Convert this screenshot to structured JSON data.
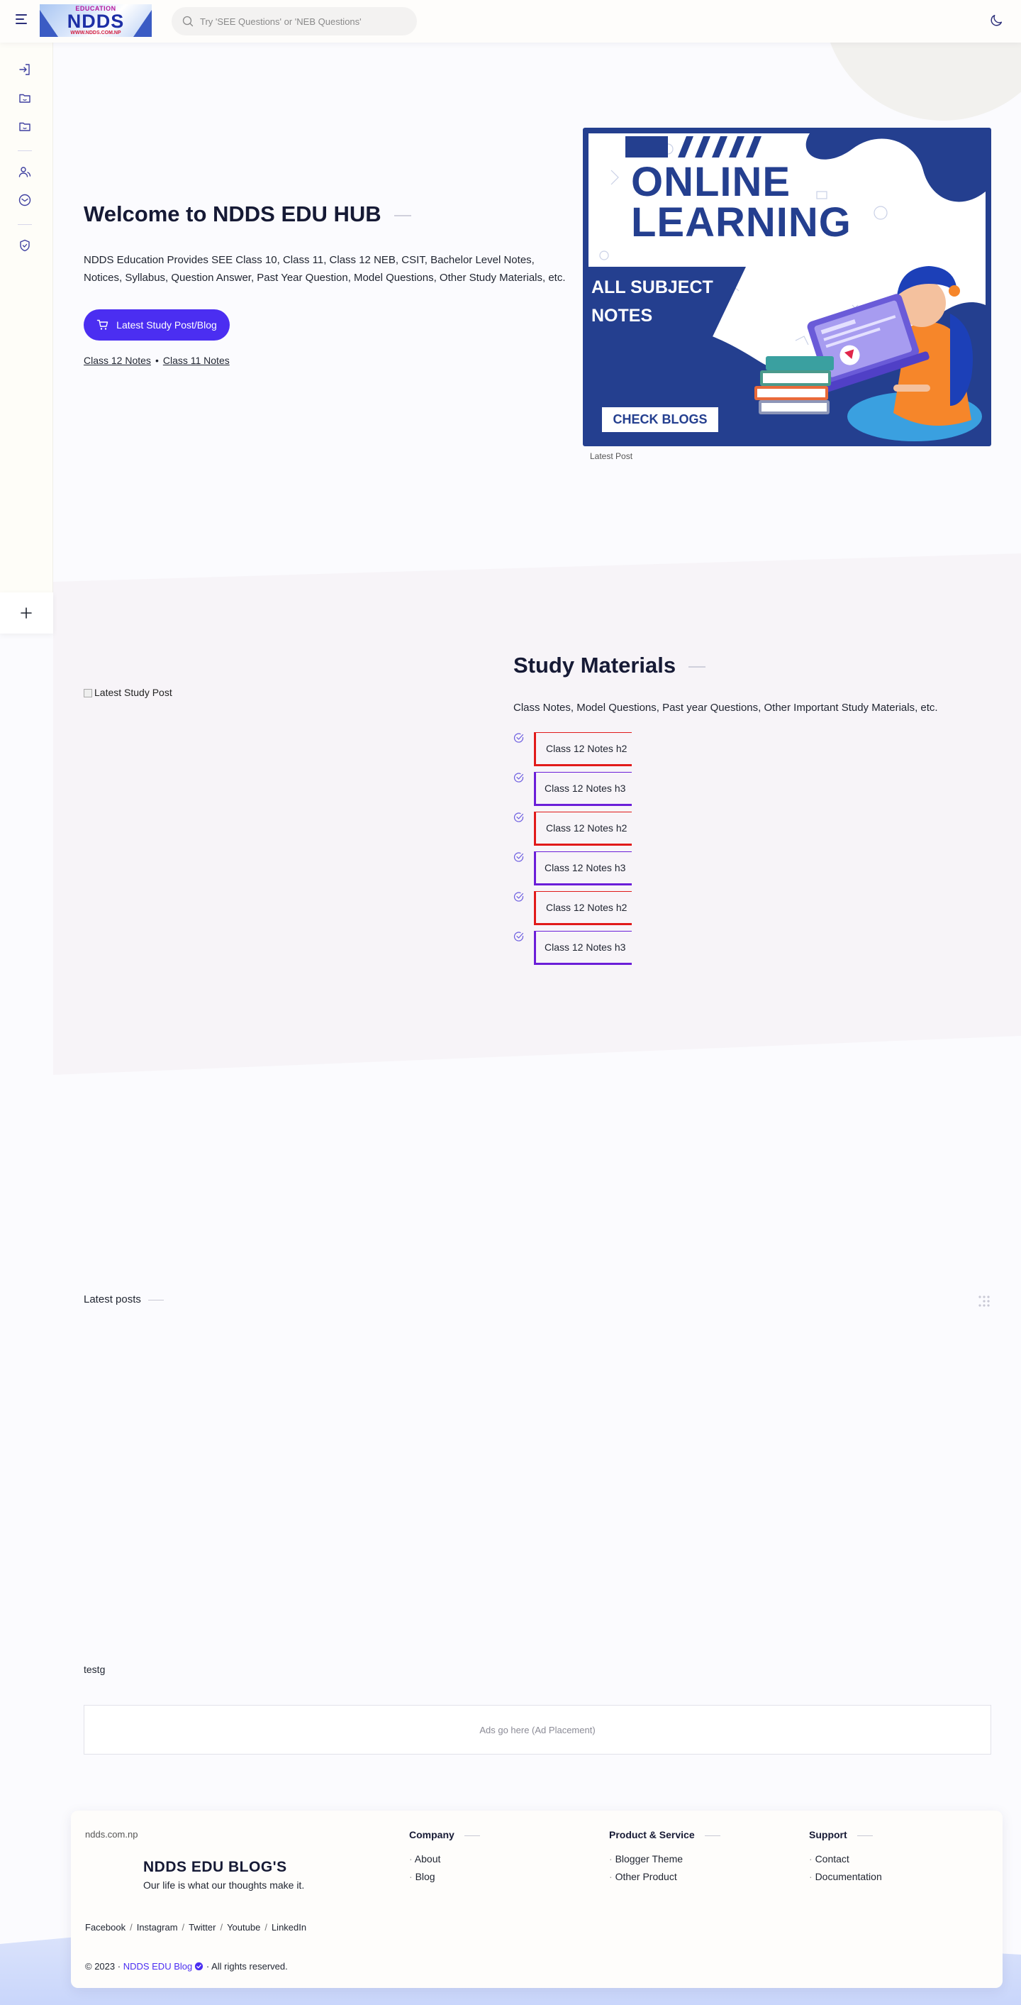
{
  "header": {
    "logo": {
      "top": "EDUCATION",
      "name": "NDDS",
      "url": "WWW.NDDS.COM.NP"
    },
    "search_placeholder": "Try 'SEE Questions' or 'NEB Questions'"
  },
  "hero": {
    "title": "Welcome to NDDS EDU HUB",
    "description": "NDDS Education Provides SEE Class 10, Class 11, Class 12 NEB, CSIT, Bachelor Level Notes, Notices, Syllabus, Question Answer, Past Year Question, Model Questions, Other Study Materials, etc.",
    "cta_label": "Latest Study Post/Blog",
    "links": [
      "Class 12 Notes",
      "Class 11 Notes"
    ],
    "banner": {
      "line1": "ONLINE",
      "line2": "LEARNING",
      "sub1": "ALL SUBJECT",
      "sub2": "NOTES",
      "button": "CHECK BLOGS"
    },
    "banner_caption": "Latest Post"
  },
  "study": {
    "image_alt": "Latest Study Post",
    "title": "Study Materials",
    "description": "Class Notes, Model Questions, Past year Questions, Other Important Study Materials, etc.",
    "items": [
      {
        "label": "Class 12 Notes h2",
        "level": "h2"
      },
      {
        "label": "Class 12 Notes h3",
        "level": "h3"
      },
      {
        "label": "Class 12 Notes h2",
        "level": "h2"
      },
      {
        "label": "Class 12 Notes h3",
        "level": "h3"
      },
      {
        "label": "Class 12 Notes h2",
        "level": "h2"
      },
      {
        "label": "Class 12 Notes h3",
        "level": "h3"
      }
    ]
  },
  "latest": {
    "title": "Latest posts",
    "test_text": "testg",
    "ad_text": "Ads go here (Ad Placement)"
  },
  "footer": {
    "domain": "ndds.com.np",
    "brand_name": "NDDS EDU BLOG'S",
    "brand_tagline": "Our life is what our thoughts make it.",
    "columns": [
      {
        "title": "Company",
        "links": [
          "About",
          "Blog"
        ]
      },
      {
        "title": "Product & Service",
        "links": [
          "Blogger Theme",
          "Other Product"
        ]
      },
      {
        "title": "Support",
        "links": [
          "Contact",
          "Documentation"
        ]
      }
    ],
    "social": [
      "Facebook",
      "Instagram",
      "Twitter",
      "Youtube",
      "LinkedIn"
    ],
    "copyright_prefix": "© 2023 ·",
    "copyright_brand": "NDDS EDU Blog",
    "copyright_suffix": "· All rights reserved."
  },
  "colors": {
    "accent": "#4b2ef1",
    "banner_blue": "#243f8f",
    "h2_border": "#e11a1a",
    "h3_border": "#6b1ed8"
  }
}
